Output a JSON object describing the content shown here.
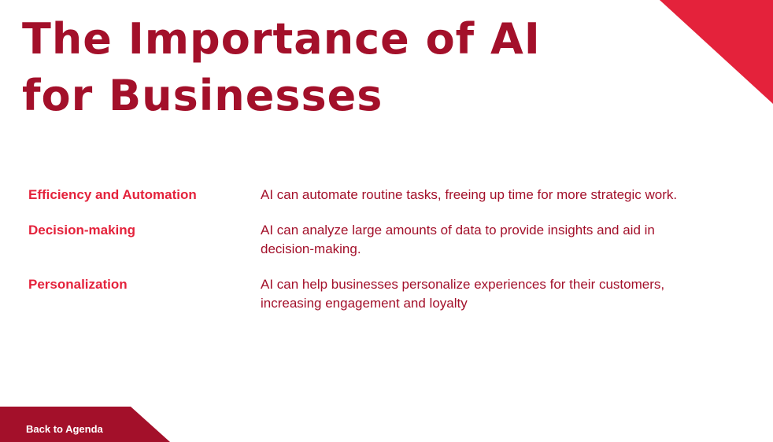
{
  "slide": {
    "title_line1": "The Importance of AI",
    "title_line2": "for Businesses",
    "rows": [
      {
        "label": "Efficiency and Automation",
        "description": "AI can automate routine tasks, freeing up time for more strategic work."
      },
      {
        "label": "Decision-making",
        "description": "AI can analyze large amounts of data to provide insights and aid in decision-making."
      },
      {
        "label": "Personalization",
        "description": "AI can help businesses personalize experiences for their customers, increasing engagement and loyalty"
      }
    ],
    "back_button_label": "Back to Agenda"
  },
  "colors": {
    "title": "#a3102a",
    "accent": "#e4223b",
    "body_text": "#a3102a",
    "button_bg": "#a3102a",
    "button_text": "#ffffff",
    "background": "#ffffff"
  }
}
